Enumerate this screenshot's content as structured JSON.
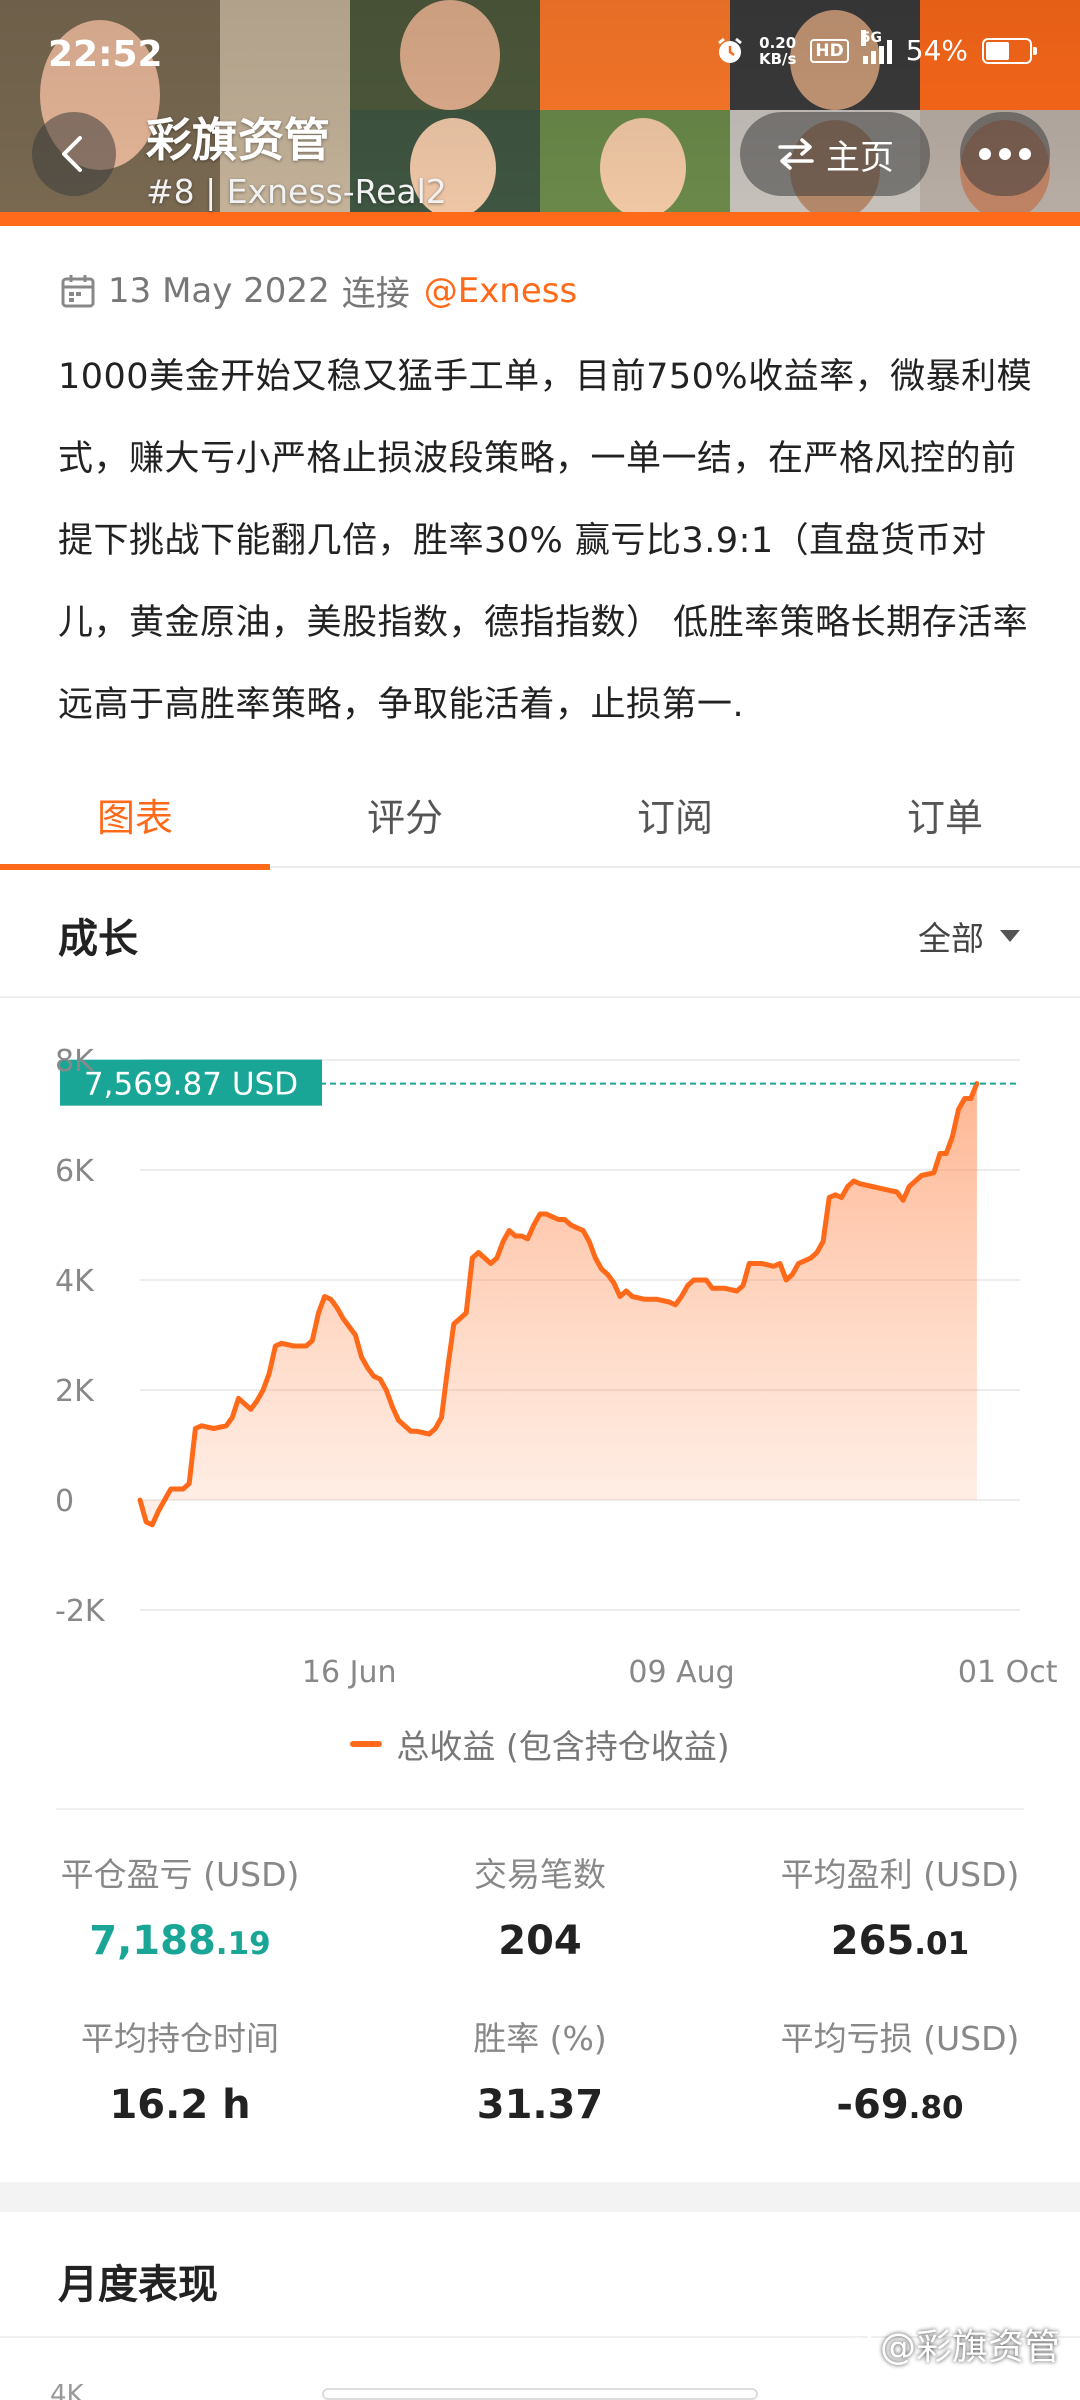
{
  "status_bar": {
    "time": "22:52",
    "net_speed_value": "0.20",
    "net_speed_unit": "KB/s",
    "hd_label": "HD",
    "network_label": "5G",
    "battery": "54%",
    "battery_level": 0.54
  },
  "header": {
    "title": "彩旗资管",
    "subtitle": "#8 | Exness-Real2",
    "home_label": "主页",
    "accent_color": "#ff6a1a"
  },
  "profile": {
    "date": "13 May 2022",
    "connect_text": "连接",
    "handle": "@Exness",
    "description": "1000美金开始又稳又猛手工单，目前750%收益率，微暴利模式，赚大亏小严格止损波段策略，一单一结，在严格风控的前提下挑战下能翻几倍，胜率30% 赢亏比3.9:1（直盘货币对儿，黄金原油，美股指数，德指指数） 低胜率策略长期存活率远高于高胜率策略，争取能活着，止损第一."
  },
  "tabs": [
    {
      "label": "图表",
      "active": true
    },
    {
      "label": "评分",
      "active": false
    },
    {
      "label": "订阅",
      "active": false
    },
    {
      "label": "订单",
      "active": false
    }
  ],
  "growth": {
    "title": "成长",
    "filter": "全部"
  },
  "chart_data": {
    "type": "area",
    "current_label": "7,569.87 USD",
    "current_value": 7569.87,
    "ylim": [
      -2000,
      8000
    ],
    "y_ticks": [
      {
        "label": "8K",
        "value": 8000
      },
      {
        "label": "6K",
        "value": 6000
      },
      {
        "label": "4K",
        "value": 4000
      },
      {
        "label": "2K",
        "value": 2000
      },
      {
        "label": "0",
        "value": 0
      },
      {
        "label": "-2K",
        "value": -2000
      }
    ],
    "x_range": [
      0,
      143
    ],
    "x_ticks": [
      {
        "label": "16 Jun",
        "day": 34
      },
      {
        "label": "09 Aug",
        "day": 88
      },
      {
        "label": "01 Oct",
        "day": 141
      }
    ],
    "legend": "总收益 (包含持仓收益)",
    "series_color": "#ff6a1a",
    "points": [
      [
        0,
        0
      ],
      [
        1,
        -400
      ],
      [
        2,
        -450
      ],
      [
        3,
        -200
      ],
      [
        4,
        0
      ],
      [
        5,
        200
      ],
      [
        7,
        200
      ],
      [
        8,
        300
      ],
      [
        9,
        1300
      ],
      [
        10,
        1350
      ],
      [
        12,
        1300
      ],
      [
        14,
        1350
      ],
      [
        15,
        1500
      ],
      [
        16,
        1850
      ],
      [
        17,
        1750
      ],
      [
        18,
        1650
      ],
      [
        19,
        1800
      ],
      [
        20,
        2000
      ],
      [
        21,
        2300
      ],
      [
        22,
        2800
      ],
      [
        23,
        2850
      ],
      [
        25,
        2800
      ],
      [
        27,
        2800
      ],
      [
        28,
        2900
      ],
      [
        29,
        3400
      ],
      [
        30,
        3700
      ],
      [
        31,
        3650
      ],
      [
        32,
        3500
      ],
      [
        33,
        3300
      ],
      [
        35,
        3000
      ],
      [
        36,
        2600
      ],
      [
        37,
        2400
      ],
      [
        38,
        2250
      ],
      [
        39,
        2200
      ],
      [
        40,
        2000
      ],
      [
        41,
        1700
      ],
      [
        42,
        1450
      ],
      [
        44,
        1250
      ],
      [
        45,
        1250
      ],
      [
        47,
        1200
      ],
      [
        48,
        1300
      ],
      [
        49,
        1500
      ],
      [
        50,
        2400
      ],
      [
        51,
        3200
      ],
      [
        52,
        3300
      ],
      [
        53,
        3400
      ],
      [
        54,
        4400
      ],
      [
        55,
        4500
      ],
      [
        56,
        4400
      ],
      [
        57,
        4300
      ],
      [
        58,
        4400
      ],
      [
        59,
        4700
      ],
      [
        60,
        4900
      ],
      [
        61,
        4800
      ],
      [
        62,
        4800
      ],
      [
        63,
        4750
      ],
      [
        64,
        5000
      ],
      [
        65,
        5200
      ],
      [
        66,
        5200
      ],
      [
        67,
        5150
      ],
      [
        68,
        5100
      ],
      [
        69,
        5100
      ],
      [
        70,
        5000
      ],
      [
        71,
        4950
      ],
      [
        72,
        4900
      ],
      [
        73,
        4700
      ],
      [
        74,
        4400
      ],
      [
        75,
        4200
      ],
      [
        76,
        4100
      ],
      [
        77,
        3950
      ],
      [
        78,
        3700
      ],
      [
        79,
        3800
      ],
      [
        80,
        3700
      ],
      [
        82,
        3650
      ],
      [
        84,
        3650
      ],
      [
        86,
        3600
      ],
      [
        87,
        3550
      ],
      [
        88,
        3700
      ],
      [
        89,
        3900
      ],
      [
        90,
        4000
      ],
      [
        92,
        4000
      ],
      [
        93,
        3850
      ],
      [
        95,
        3850
      ],
      [
        97,
        3800
      ],
      [
        98,
        3900
      ],
      [
        99,
        4300
      ],
      [
        101,
        4300
      ],
      [
        103,
        4250
      ],
      [
        104,
        4300
      ],
      [
        105,
        4000
      ],
      [
        106,
        4100
      ],
      [
        107,
        4300
      ],
      [
        108,
        4350
      ],
      [
        109,
        4400
      ],
      [
        110,
        4500
      ],
      [
        111,
        4700
      ],
      [
        112,
        5500
      ],
      [
        113,
        5550
      ],
      [
        114,
        5500
      ],
      [
        115,
        5700
      ],
      [
        116,
        5800
      ],
      [
        117,
        5750
      ],
      [
        119,
        5700
      ],
      [
        121,
        5650
      ],
      [
        123,
        5600
      ],
      [
        124,
        5450
      ],
      [
        125,
        5700
      ],
      [
        126,
        5800
      ],
      [
        127,
        5900
      ],
      [
        129,
        5950
      ],
      [
        130,
        6300
      ],
      [
        131,
        6300
      ],
      [
        132,
        6600
      ],
      [
        133,
        7100
      ],
      [
        134,
        7300
      ],
      [
        135,
        7300
      ],
      [
        136,
        7570
      ]
    ]
  },
  "stats": [
    {
      "label": "平仓盈亏 (USD)",
      "int": "7,188",
      "dec": ".19",
      "highlight": true
    },
    {
      "label": "交易笔数",
      "int": "204",
      "dec": "",
      "highlight": false
    },
    {
      "label": "平均盈利 (USD)",
      "int": "265",
      "dec": ".01",
      "highlight": false
    },
    {
      "label": "平均持仓时间",
      "int": "16.2 h",
      "dec": "",
      "highlight": false
    },
    {
      "label": "胜率 (%)",
      "int": "31.37",
      "dec": "",
      "highlight": false
    },
    {
      "label": "平均亏损 (USD)",
      "int": "-69",
      "dec": ".80",
      "highlight": false
    }
  ],
  "monthly": {
    "title": "月度表现",
    "first_tick": "4K"
  },
  "watermark": "@彩旗资管"
}
